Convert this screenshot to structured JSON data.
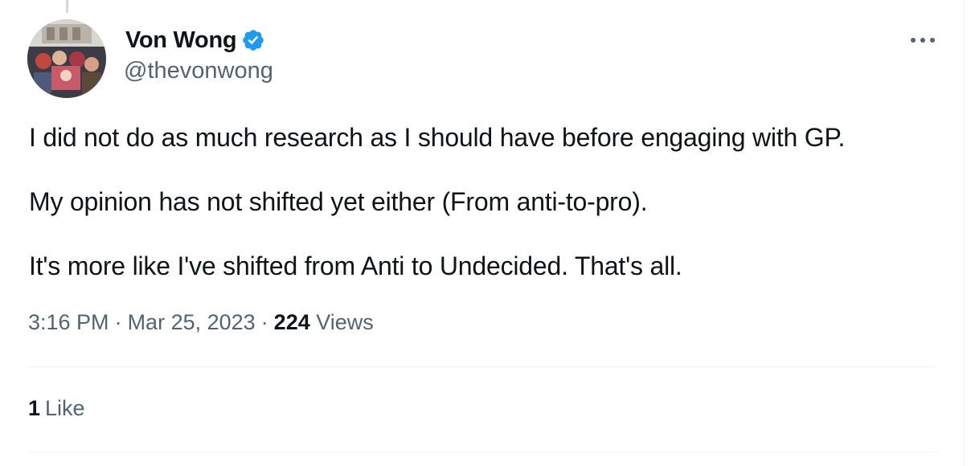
{
  "author": {
    "display_name": "Von Wong",
    "handle": "@thevonwong",
    "verified_icon": "verified-badge-icon",
    "verified_color": "#1d9bf0"
  },
  "tweet": {
    "paragraphs": [
      "I did not do as much research as I should have before engaging with GP.",
      "My opinion has not shifted yet either (From anti-to-pro).",
      "It's more like I've shifted from Anti to Undecided. That's all."
    ],
    "time": "3:16 PM",
    "date": "Mar 25, 2023",
    "separator": "·",
    "views_count": "224",
    "views_label": "Views"
  },
  "engagement": {
    "likes_count": "1",
    "likes_label": "Like"
  },
  "icons": {
    "more": "more-options-icon"
  },
  "colors": {
    "text_primary": "#0f1419",
    "text_secondary": "#536471",
    "divider": "#eff3f4",
    "accent": "#1d9bf0"
  }
}
